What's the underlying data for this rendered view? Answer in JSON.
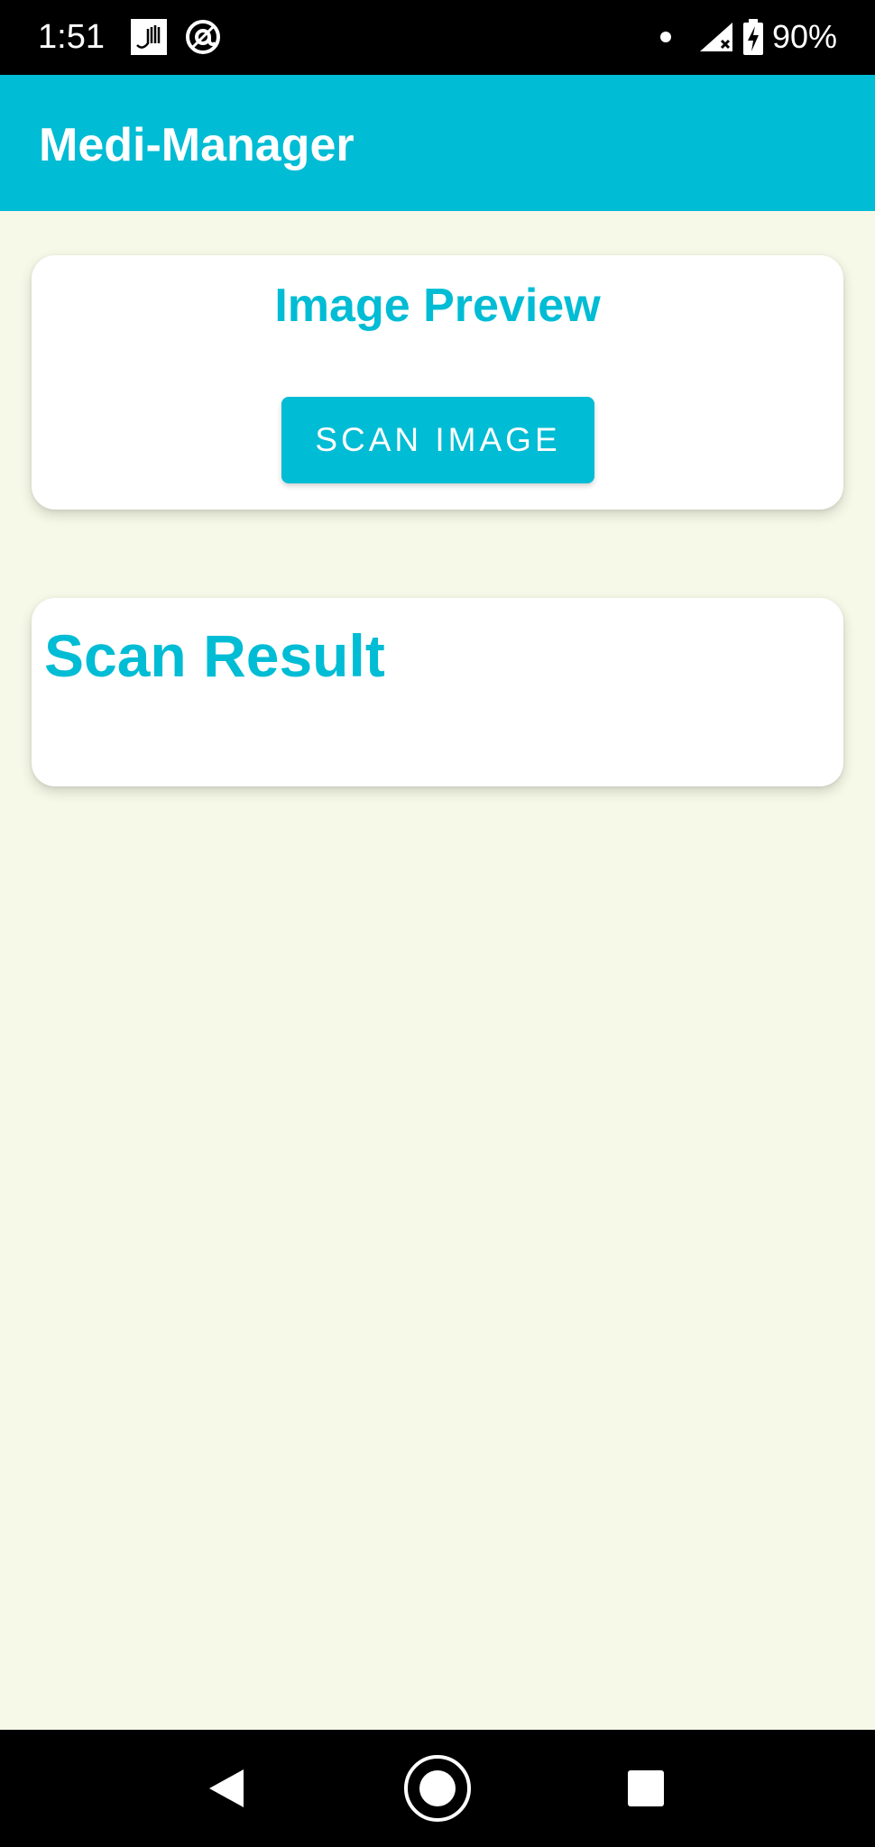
{
  "status_bar": {
    "time": "1:51",
    "battery_text": "90%",
    "icons": [
      "app-notification-icon",
      "at-sign-icon",
      "notification-dot-icon",
      "signal-icon",
      "battery-charging-icon"
    ]
  },
  "app_bar": {
    "title": "Medi-Manager"
  },
  "preview_card": {
    "title": "Image Preview",
    "button_label": "SCAN IMAGE"
  },
  "result_card": {
    "title": "Scan Result",
    "body": ""
  },
  "nav_bar": {
    "icons": [
      "back-icon",
      "home-icon",
      "recents-icon"
    ]
  },
  "colors": {
    "accent": "#00bcd4",
    "background": "#f7f9e8",
    "card": "#ffffff",
    "system_bars": "#000000"
  }
}
